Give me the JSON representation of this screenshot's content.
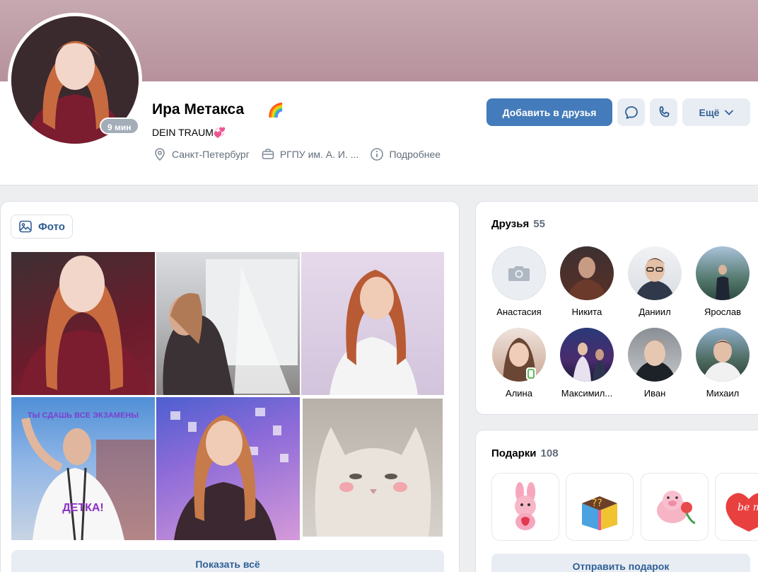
{
  "profile": {
    "name": "Ира Метакса",
    "name_emoji": "🌈",
    "status": "DEIN TRAUM",
    "status_emoji": "💞",
    "online": "9 мин",
    "city": "Санкт-Петербург",
    "education": "РГПУ им. А. И. ...",
    "more_info": "Подробнее"
  },
  "actions": {
    "add_friend": "Добавить в друзья",
    "more": "Ещё"
  },
  "photos": {
    "tab_label": "Фото",
    "meme_top": "ТЫ СДАШЬ ВСЕ ЭКЗАМЕНЫ",
    "meme_bottom": "ДЕТКА!",
    "show_all": "Показать всё"
  },
  "friends": {
    "title": "Друзья",
    "count": "55",
    "items": [
      {
        "name": "Анастасия"
      },
      {
        "name": "Никита"
      },
      {
        "name": "Даниил"
      },
      {
        "name": "Ярослав"
      },
      {
        "name": "Алина"
      },
      {
        "name": "Максимил..."
      },
      {
        "name": "Иван"
      },
      {
        "name": "Михаил"
      }
    ]
  },
  "gifts": {
    "title": "Подарки",
    "count": "108",
    "send": "Отправить подарок"
  },
  "colors": {
    "accent": "#447bba",
    "link": "#2f5f95",
    "secondary_bg": "#e8edf3"
  }
}
